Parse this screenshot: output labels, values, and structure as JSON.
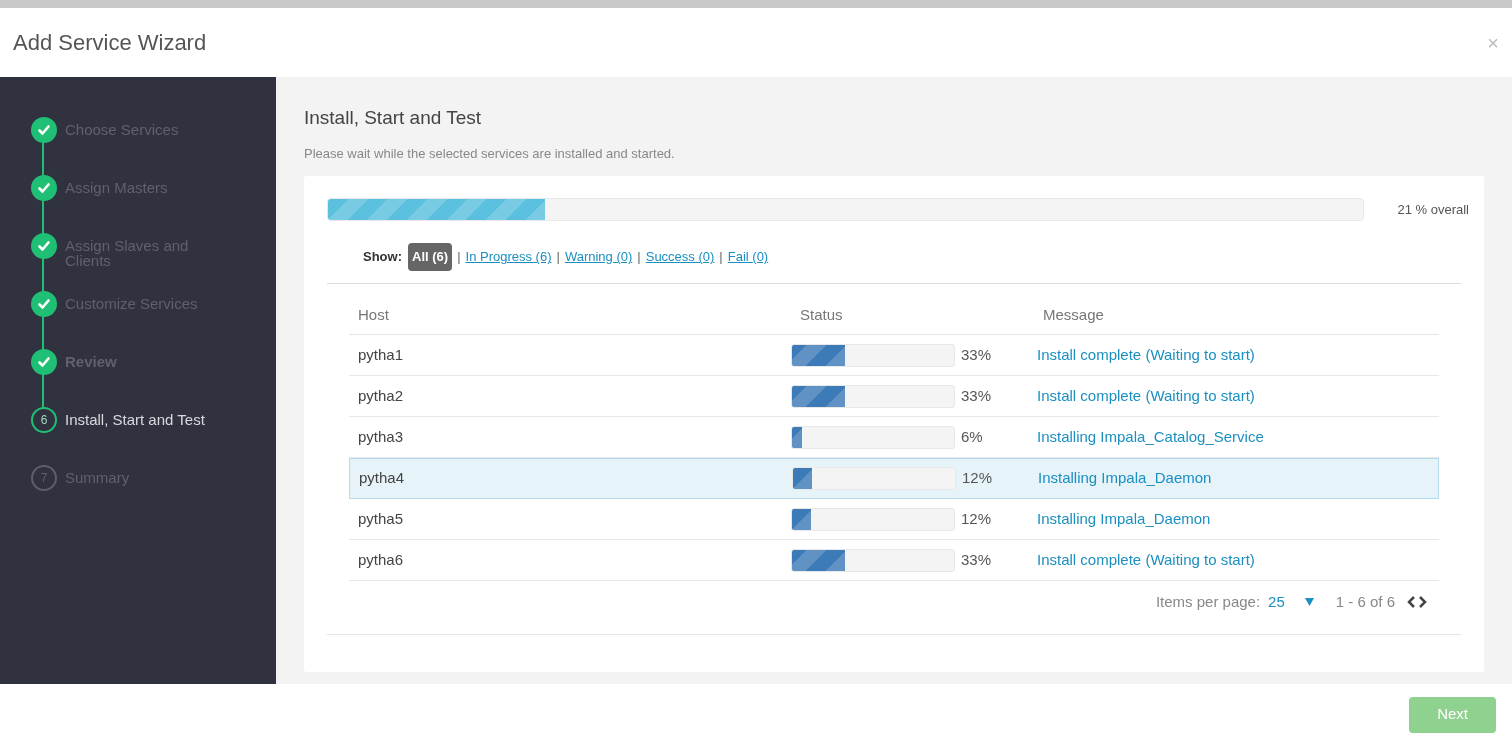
{
  "window": {
    "title": "Add Service Wizard",
    "close": "×"
  },
  "steps": [
    {
      "label": "Choose Services",
      "done": true,
      "current": false
    },
    {
      "label": "Assign Masters",
      "done": true,
      "current": false
    },
    {
      "label": "Assign Slaves and Clients",
      "done": true,
      "current": false
    },
    {
      "label": "Customize Services",
      "done": true,
      "current": false
    },
    {
      "label": "Review",
      "done": true,
      "current": false
    },
    {
      "label": "Install, Start and Test",
      "done": false,
      "current": true,
      "number": "6"
    },
    {
      "label": "Summary",
      "done": false,
      "current": false,
      "number": "7"
    }
  ],
  "page": {
    "title": "Install, Start and Test",
    "subtitle": "Please wait while the selected services are installed and started."
  },
  "overall": {
    "level": 0.21,
    "reading": "21 % overall"
  },
  "filter": {
    "label": "Show:",
    "separators": [
      "|",
      "|",
      "|",
      "|"
    ],
    "options": [
      {
        "label": "All (6)",
        "selected": true
      },
      {
        "label": "In Progress (6)",
        "selected": false
      },
      {
        "label": "Warning (0)",
        "selected": false
      },
      {
        "label": "Success (0)",
        "selected": false
      },
      {
        "label": "Fail (0)",
        "selected": false
      }
    ]
  },
  "table": {
    "columns": [
      "Host",
      "Status",
      "Message"
    ],
    "rows": [
      {
        "host": "pytha1",
        "level": 0.33,
        "percent": "33%",
        "message": "Install complete (Waiting to start)",
        "selected": false
      },
      {
        "host": "pytha2",
        "level": 0.33,
        "percent": "33%",
        "message": "Install complete (Waiting to start)",
        "selected": false
      },
      {
        "host": "pytha3",
        "level": 0.06,
        "percent": "6%",
        "message": "Installing Impala_Catalog_Service",
        "selected": false
      },
      {
        "host": "pytha4",
        "level": 0.12,
        "percent": "12%",
        "message": "Installing Impala_Daemon",
        "selected": true
      },
      {
        "host": "pytha5",
        "level": 0.12,
        "percent": "12%",
        "message": "Installing Impala_Daemon",
        "selected": false
      },
      {
        "host": "pytha6",
        "level": 0.33,
        "percent": "33%",
        "message": "Install complete (Waiting to start)",
        "selected": false
      }
    ]
  },
  "pagination": {
    "label": "Items per page:",
    "per_page": "25",
    "range": "1 - 6 of 6"
  },
  "footer": {
    "next": "Next"
  }
}
